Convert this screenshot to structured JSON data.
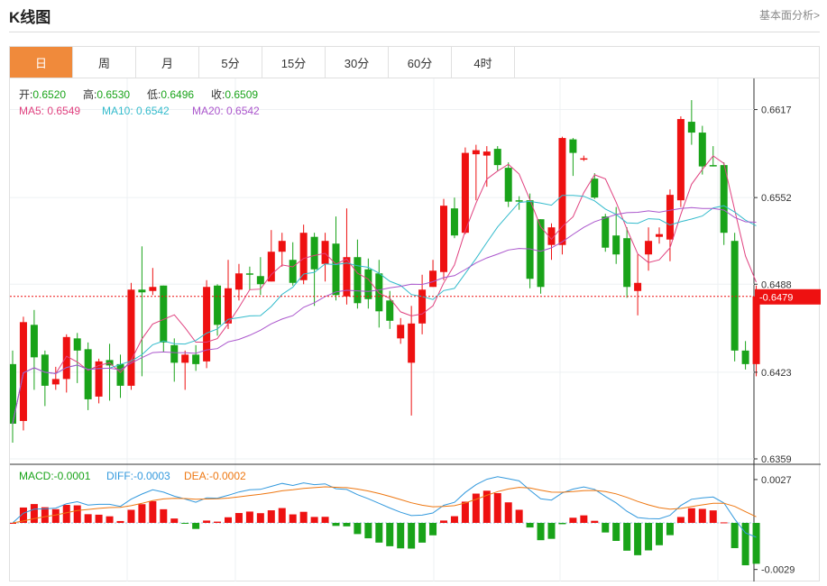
{
  "header": {
    "title": "K线图",
    "more_link": "基本面分析>"
  },
  "tabs": [
    {
      "label": "日",
      "active": true
    },
    {
      "label": "周",
      "active": false
    },
    {
      "label": "月",
      "active": false
    },
    {
      "label": "5分",
      "active": false
    },
    {
      "label": "15分",
      "active": false
    },
    {
      "label": "30分",
      "active": false
    },
    {
      "label": "60分",
      "active": false
    },
    {
      "label": "4时",
      "active": false
    }
  ],
  "colors": {
    "up": "#ee1111",
    "down": "#19a319",
    "ma5": "#e0417f",
    "ma10": "#33bbcc",
    "ma20": "#aa55cc",
    "diff": "#3399dd",
    "dea": "#ee7711",
    "price_tag": "#ee1111",
    "active_tab": "#f08a3b"
  },
  "chart_data": {
    "type": "candlestick",
    "ohlc_legend": [
      {
        "label": "开:",
        "value": "0.6520"
      },
      {
        "label": "高:",
        "value": "0.6530"
      },
      {
        "label": "低:",
        "value": "0.6496"
      },
      {
        "label": "收:",
        "value": "0.6509"
      }
    ],
    "ma_legend": [
      {
        "label": "MA5:",
        "value": "0.6549",
        "color": "#e0417f"
      },
      {
        "label": "MA10:",
        "value": "0.6542",
        "color": "#33bbcc"
      },
      {
        "label": "MA20:",
        "value": "0.6542",
        "color": "#aa55cc"
      }
    ],
    "price_axis_ticks": [
      "0.6617",
      "0.6552",
      "0.6488",
      "0.6423",
      "0.6359"
    ],
    "last_price": "0.6479",
    "ylim": [
      0.6355,
      0.664
    ],
    "candles": [
      [
        0.6429,
        0.6385,
        0.6439,
        0.6371
      ],
      [
        0.6387,
        0.646,
        0.6464,
        0.638
      ],
      [
        0.6458,
        0.6434,
        0.6469,
        0.641
      ],
      [
        0.6436,
        0.6413,
        0.6439,
        0.6398
      ],
      [
        0.6414,
        0.6418,
        0.6427,
        0.641
      ],
      [
        0.6418,
        0.6449,
        0.6451,
        0.6408
      ],
      [
        0.6448,
        0.6439,
        0.6452,
        0.6415
      ],
      [
        0.644,
        0.6403,
        0.6445,
        0.6395
      ],
      [
        0.6405,
        0.6431,
        0.6433,
        0.64
      ],
      [
        0.6432,
        0.6428,
        0.6444,
        0.6402
      ],
      [
        0.6429,
        0.6413,
        0.6436,
        0.6404
      ],
      [
        0.6413,
        0.6484,
        0.6489,
        0.641
      ],
      [
        0.6484,
        0.6482,
        0.6516,
        0.642
      ],
      [
        0.6483,
        0.6486,
        0.65,
        0.648
      ],
      [
        0.6487,
        0.6445,
        0.6487,
        0.6438
      ],
      [
        0.6443,
        0.643,
        0.6448,
        0.6416
      ],
      [
        0.643,
        0.6436,
        0.6439,
        0.641
      ],
      [
        0.6436,
        0.6429,
        0.6443,
        0.6424
      ],
      [
        0.6431,
        0.6486,
        0.6491,
        0.6426
      ],
      [
        0.6487,
        0.6458,
        0.6488,
        0.645
      ],
      [
        0.6459,
        0.6485,
        0.6506,
        0.6455
      ],
      [
        0.6484,
        0.6496,
        0.6503,
        0.6476
      ],
      [
        0.6496,
        0.6495,
        0.6501,
        0.6484
      ],
      [
        0.6494,
        0.6488,
        0.6508,
        0.648
      ],
      [
        0.649,
        0.6512,
        0.6528,
        0.649
      ],
      [
        0.6512,
        0.652,
        0.6526,
        0.6501
      ],
      [
        0.6506,
        0.6489,
        0.6519,
        0.6487
      ],
      [
        0.6491,
        0.6526,
        0.6532,
        0.6488
      ],
      [
        0.6523,
        0.6499,
        0.6526,
        0.6472
      ],
      [
        0.6503,
        0.652,
        0.6526,
        0.649
      ],
      [
        0.6518,
        0.648,
        0.6538,
        0.6476
      ],
      [
        0.6479,
        0.6508,
        0.6544,
        0.6473
      ],
      [
        0.6508,
        0.6474,
        0.6521,
        0.647
      ],
      [
        0.6499,
        0.6477,
        0.6507,
        0.647
      ],
      [
        0.6496,
        0.6468,
        0.6506,
        0.6456
      ],
      [
        0.6476,
        0.6461,
        0.6483,
        0.6455
      ],
      [
        0.6448,
        0.6458,
        0.6463,
        0.6444
      ],
      [
        0.643,
        0.6459,
        0.6472,
        0.6391
      ],
      [
        0.6459,
        0.6484,
        0.6495,
        0.6451
      ],
      [
        0.6486,
        0.6498,
        0.6506,
        0.6486
      ],
      [
        0.6497,
        0.6546,
        0.6551,
        0.6491
      ],
      [
        0.6544,
        0.6524,
        0.6552,
        0.6522
      ],
      [
        0.6526,
        0.6585,
        0.6589,
        0.6525
      ],
      [
        0.6584,
        0.6587,
        0.6591,
        0.655
      ],
      [
        0.6583,
        0.6586,
        0.659,
        0.656
      ],
      [
        0.6588,
        0.6576,
        0.659,
        0.6572
      ],
      [
        0.6574,
        0.6549,
        0.6578,
        0.6545
      ],
      [
        0.655,
        0.6549,
        0.6553,
        0.6543
      ],
      [
        0.655,
        0.6492,
        0.6555,
        0.6485
      ],
      [
        0.6536,
        0.6486,
        0.6536,
        0.6481
      ],
      [
        0.6517,
        0.653,
        0.6533,
        0.6506
      ],
      [
        0.6517,
        0.6596,
        0.6597,
        0.651
      ],
      [
        0.6595,
        0.6585,
        0.6596,
        0.6568
      ],
      [
        0.6581,
        0.6581,
        0.6583,
        0.6579
      ],
      [
        0.6566,
        0.6552,
        0.657,
        0.6551
      ],
      [
        0.6538,
        0.6515,
        0.654,
        0.6512
      ],
      [
        0.6524,
        0.651,
        0.6545,
        0.6503
      ],
      [
        0.6522,
        0.6486,
        0.653,
        0.6478
      ],
      [
        0.6483,
        0.6489,
        0.651,
        0.6465
      ],
      [
        0.651,
        0.652,
        0.653,
        0.6498
      ],
      [
        0.6523,
        0.6525,
        0.653,
        0.6518
      ],
      [
        0.6521,
        0.6554,
        0.6558,
        0.6505
      ],
      [
        0.655,
        0.661,
        0.6612,
        0.6545
      ],
      [
        0.6608,
        0.66,
        0.6624,
        0.6591
      ],
      [
        0.66,
        0.6575,
        0.6605,
        0.6569
      ],
      [
        0.6576,
        0.6575,
        0.659,
        0.6575
      ],
      [
        0.6576,
        0.6526,
        0.6578,
        0.6517
      ],
      [
        0.652,
        0.6439,
        0.6526,
        0.6431
      ],
      [
        0.6439,
        0.6429,
        0.6446,
        0.6425
      ],
      [
        0.6429,
        0.6479,
        0.6487,
        0.642
      ]
    ],
    "macd_legend": [
      {
        "label": "MACD:",
        "value": "-0.0001",
        "color": "#19a319"
      },
      {
        "label": "DIFF:",
        "value": "-0.0003",
        "color": "#3399dd"
      },
      {
        "label": "DEA:",
        "value": "-0.0002",
        "color": "#ee7711"
      }
    ],
    "macd_axis_ticks": [
      "0.0027",
      "-0.0029"
    ],
    "macd_ylim": [
      -0.0032,
      0.0032
    ]
  }
}
